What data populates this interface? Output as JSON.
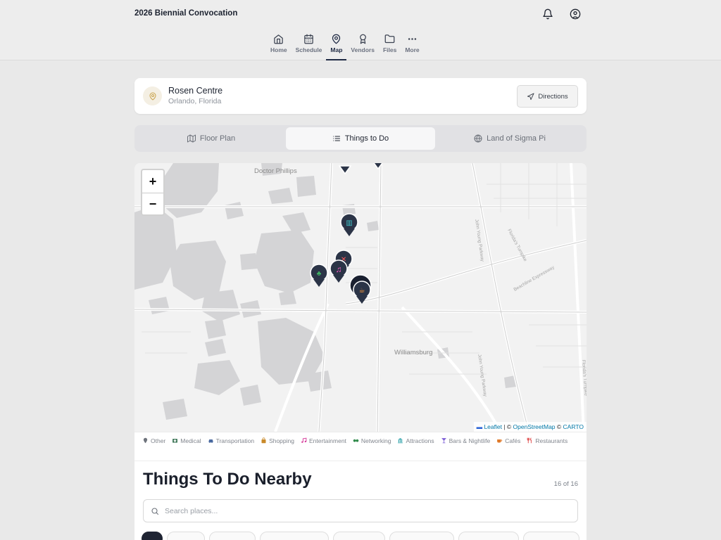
{
  "app": {
    "title": "2026 Biennial Convocation"
  },
  "nav": {
    "items": [
      {
        "label": "Home",
        "icon": "home-icon"
      },
      {
        "label": "Schedule",
        "icon": "calendar-icon"
      },
      {
        "label": "Map",
        "icon": "map-pin-icon",
        "active": true
      },
      {
        "label": "Vendors",
        "icon": "award-icon"
      },
      {
        "label": "Files",
        "icon": "folder-icon"
      },
      {
        "label": "More",
        "icon": "more-icon"
      }
    ]
  },
  "venue": {
    "name": "Rosen Centre",
    "location": "Orlando, Florida",
    "directions_label": "Directions"
  },
  "tabs": [
    {
      "label": "Floor Plan",
      "icon": "map-icon"
    },
    {
      "label": "Things to Do",
      "icon": "list-icon",
      "active": true
    },
    {
      "label": "Land of Sigma Pi",
      "icon": "globe-icon"
    }
  ],
  "map": {
    "zoom_in": "+",
    "zoom_out": "−",
    "labels": [
      "Doctor Phillips",
      "Williamsburg"
    ],
    "roads": [
      "John Young Parkway",
      "Beachline Expressway",
      "Florida's Turnpike"
    ],
    "attribution": {
      "leaflet": "Leaflet",
      "sep1": " | © ",
      "osm": "OpenStreetMap",
      "sep2": " © ",
      "carto": "CARTO"
    }
  },
  "legend": [
    {
      "label": "Other",
      "color": "#7a7f88",
      "icon": "pin-icon"
    },
    {
      "label": "Medical",
      "color": "#2e6b4a",
      "icon": "medical-icon"
    },
    {
      "label": "Transportation",
      "color": "#4a6aa0",
      "icon": "car-icon"
    },
    {
      "label": "Shopping",
      "color": "#c98a2a",
      "icon": "bag-icon"
    },
    {
      "label": "Entertainment",
      "color": "#d63a9a",
      "icon": "music-icon"
    },
    {
      "label": "Networking",
      "color": "#2f8a4a",
      "icon": "handshake-icon"
    },
    {
      "label": "Attractions",
      "color": "#2aa0a8",
      "icon": "landmark-icon"
    },
    {
      "label": "Bars & Nightlife",
      "color": "#7b5cd6",
      "icon": "cocktail-icon"
    },
    {
      "label": "Cafés",
      "color": "#e07a2a",
      "icon": "coffee-icon"
    },
    {
      "label": "Restaurants",
      "color": "#e04a4a",
      "icon": "utensils-icon"
    }
  ],
  "list": {
    "title": "Things To Do Nearby",
    "count": "16 of 16",
    "search_placeholder": "Search places..."
  },
  "colors": {
    "marker": "#2b3447",
    "accent": "#1f2a44"
  }
}
